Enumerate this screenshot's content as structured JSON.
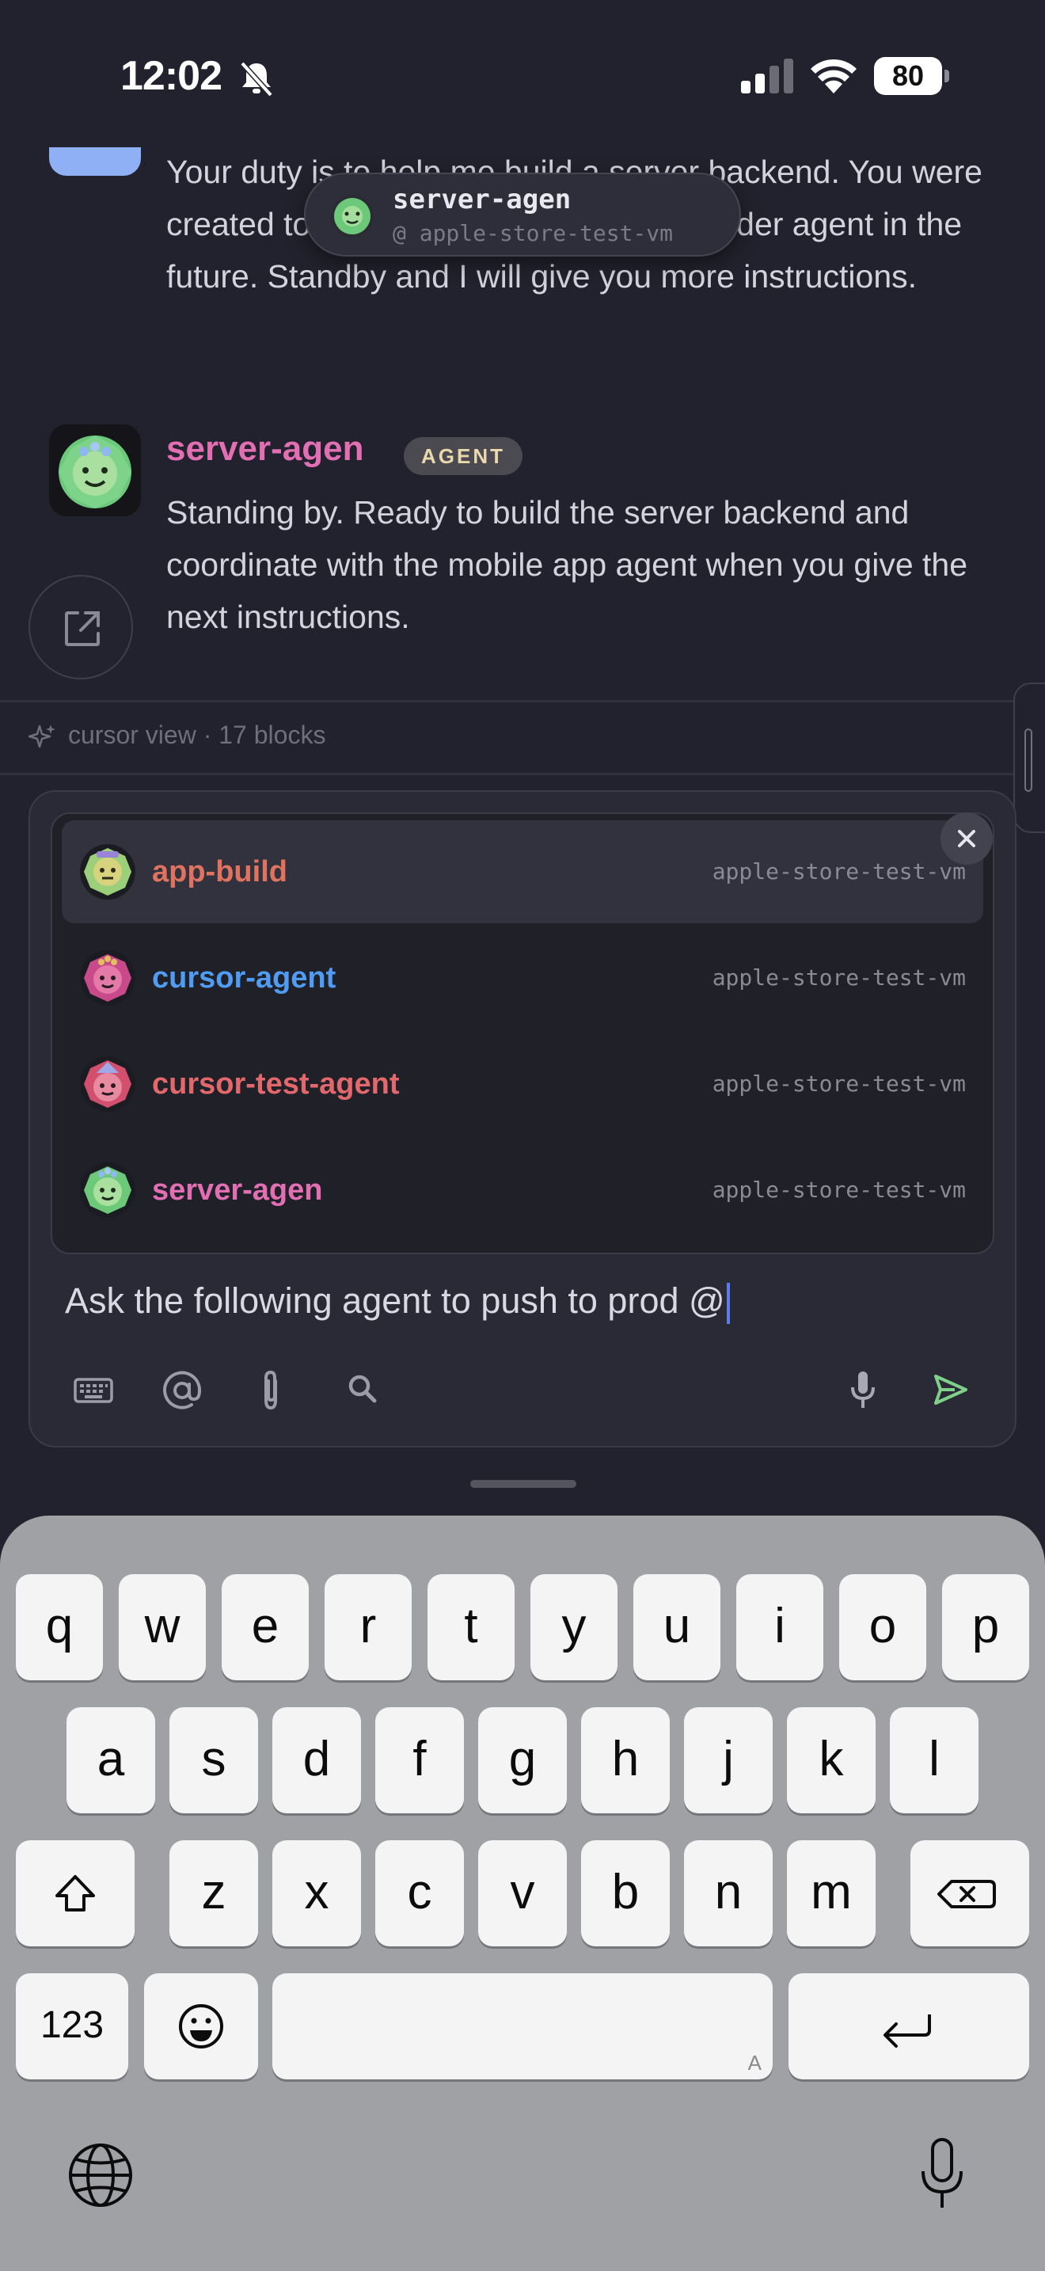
{
  "status_bar": {
    "time": "12:02",
    "battery": "80"
  },
  "messages": [
    {
      "text": "Your duty is to help me build a server backend. You were created to work with the mobile app builder agent in the future. Standby and I will give you more instructions."
    },
    {
      "author": "server-agen",
      "badge": "AGENT",
      "text": "Standing by. Ready to build the server backend and coordinate with the mobile app agent when you give the next instructions."
    }
  ],
  "tooltip": {
    "name": "server-agen",
    "host": "@ apple-store-test-vm"
  },
  "cursor_view": {
    "label": "cursor view · 17 blocks"
  },
  "mention_popup": {
    "items": [
      {
        "name": "app-build",
        "host": "apple-store-test-vm",
        "color": "#e0735f"
      },
      {
        "name": "cursor-agent",
        "host": "apple-store-test-vm",
        "color": "#4f9cf2"
      },
      {
        "name": "cursor-test-agent",
        "host": "apple-store-test-vm",
        "color": "#e2686b"
      },
      {
        "name": "server-agen",
        "host": "apple-store-test-vm",
        "color": "#e26fb3"
      }
    ]
  },
  "composer": {
    "input_value": "Ask the following agent to push to prod @",
    "tools": [
      "keyboard-icon",
      "at-sign-icon",
      "paperclip-icon",
      "search-icon",
      "microphone-icon",
      "send-icon"
    ]
  },
  "keyboard": {
    "row1": [
      "q",
      "w",
      "e",
      "r",
      "t",
      "y",
      "u",
      "i",
      "o",
      "p"
    ],
    "row2": [
      "a",
      "s",
      "d",
      "f",
      "g",
      "h",
      "j",
      "k",
      "l"
    ],
    "row3": [
      "z",
      "x",
      "c",
      "v",
      "b",
      "n",
      "m"
    ],
    "numbers_label": "123",
    "space_hint": "A"
  },
  "colors": {
    "accent_agent": "#e26fb3",
    "send": "#7fd18a",
    "caret": "#5b7cf0"
  }
}
